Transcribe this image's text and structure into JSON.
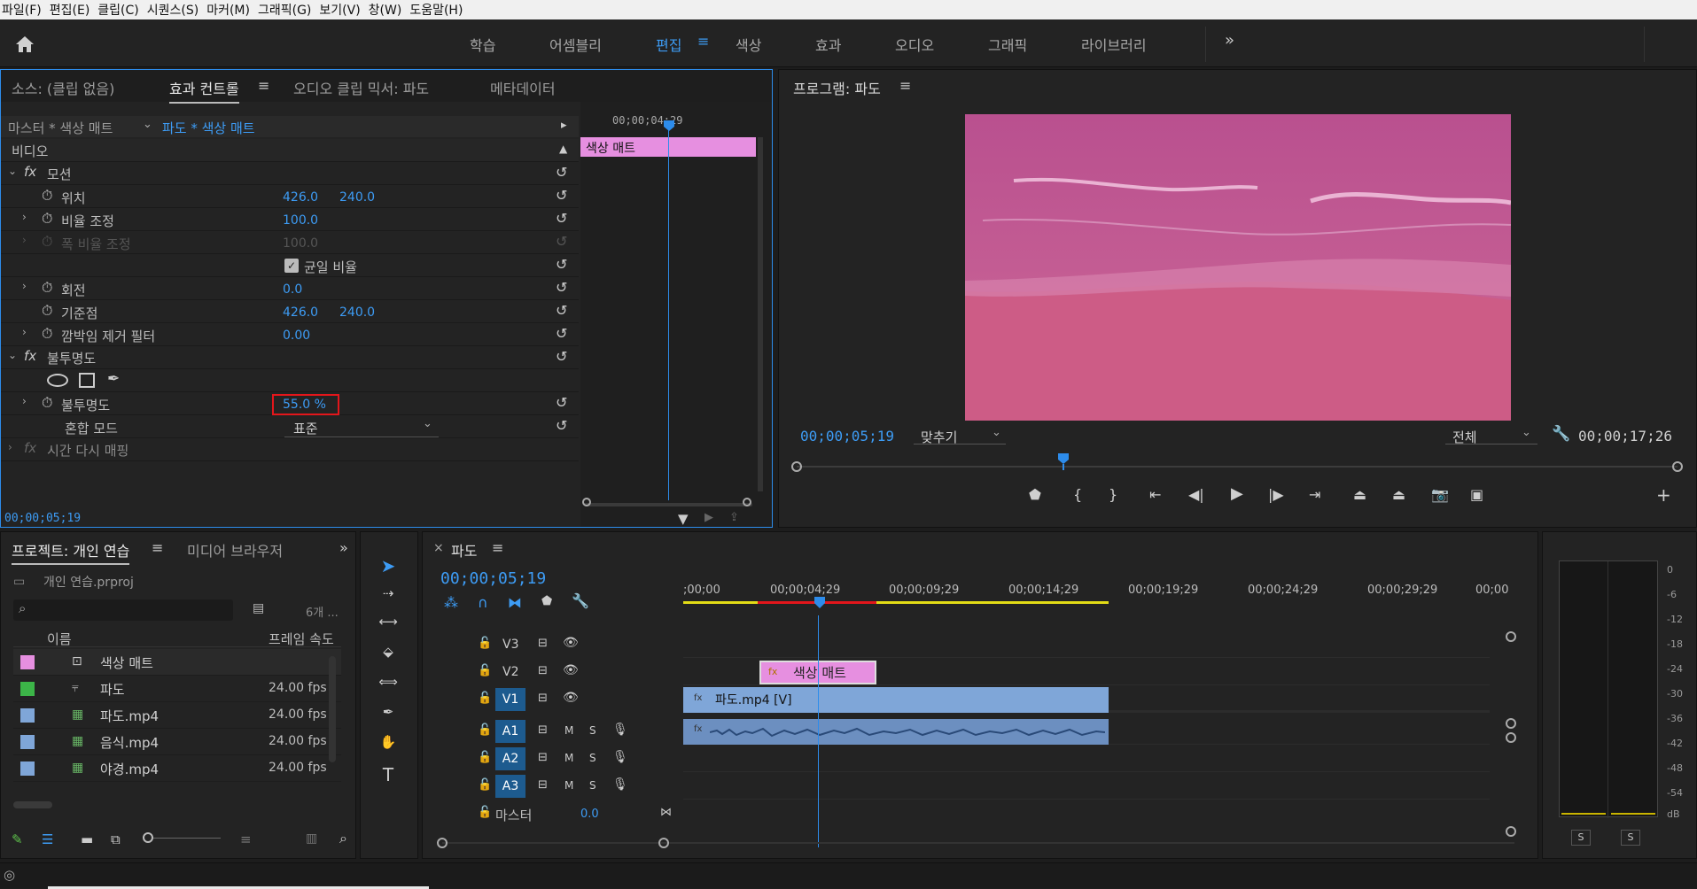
{
  "menu": [
    "파일(F)",
    "편집(E)",
    "클립(C)",
    "시퀀스(S)",
    "마커(M)",
    "그래픽(G)",
    "보기(V)",
    "창(W)",
    "도움말(H)"
  ],
  "workspaces": [
    "학습",
    "어셈블리",
    "편집",
    "색상",
    "효과",
    "오디오",
    "그래픽",
    "라이브러리"
  ],
  "workspace_active": "편집",
  "effect_panel": {
    "tabs": [
      "소스: (클립 없음)",
      "효과 컨트롤",
      "오디오 클립 믹서: 파도",
      "메타데이터"
    ],
    "master_label": "마스터 * 색상 매트",
    "clip_label": "파도 * 색상 매트",
    "mini_timecode": "00;00;04;29",
    "clip_bar": "색상 매트",
    "section_video": "비디오",
    "motion": "모션",
    "position": {
      "label": "위치",
      "x": "426.0",
      "y": "240.0"
    },
    "scale": {
      "label": "비율 조정",
      "value": "100.0"
    },
    "scale_width": {
      "label": "폭 비율 조정",
      "value": "100.0"
    },
    "uniform": "균일 비율",
    "rotation": {
      "label": "회전",
      "value": "0.0"
    },
    "anchor": {
      "label": "기준점",
      "x": "426.0",
      "y": "240.0"
    },
    "flicker": {
      "label": "깜박임 제거 필터",
      "value": "0.00"
    },
    "opacity_section": "불투명도",
    "opacity": {
      "label": "불투명도",
      "value": "55.0 %"
    },
    "blend": {
      "label": "혼합 모드",
      "value": "표준"
    },
    "time_remap": "시간 다시 매핑",
    "timecode": "00;00;05;19"
  },
  "program": {
    "title": "프로그램: 파도",
    "timecode": "00;00;05;19",
    "fit": "맞추기",
    "quality": "전체",
    "duration": "00;00;17;26"
  },
  "project": {
    "tabs": [
      "프로젝트: 개인 연습",
      "미디어 브라우저"
    ],
    "file": "개인 연습.prproj",
    "count": "6개 ...",
    "col_name": "이름",
    "col_fps": "프레임 속도",
    "items": [
      {
        "name": "색상 매트",
        "fps": "",
        "color": "#e68fe0"
      },
      {
        "name": "파도",
        "fps": "24.00 fps",
        "color": "#3cb548"
      },
      {
        "name": "파도.mp4",
        "fps": "24.00 fps",
        "color": "#7fa6d8"
      },
      {
        "name": "음식.mp4",
        "fps": "24.00 fps",
        "color": "#7fa6d8"
      },
      {
        "name": "야경.mp4",
        "fps": "24.00 fps",
        "color": "#7fa6d8"
      }
    ]
  },
  "timeline": {
    "tab": "파도",
    "timecode": "00;00;05;19",
    "ruler": [
      ";00;00",
      "00;00;04;29",
      "00;00;09;29",
      "00;00;14;29",
      "00;00;19;29",
      "00;00;24;29",
      "00;00;29;29",
      "00;00"
    ],
    "tracks_video": [
      "V3",
      "V2",
      "V1"
    ],
    "tracks_audio": [
      "A1",
      "A2",
      "A3"
    ],
    "master": "마스터",
    "master_val": "0.0",
    "clip_matte": "색상 매트",
    "clip_video": "파도.mp4 [V]"
  },
  "meter": {
    "scale": [
      "0",
      "-6",
      "-12",
      "-18",
      "-24",
      "-30",
      "-36",
      "-42",
      "-48",
      "-54",
      "dB"
    ],
    "solo": "S"
  },
  "colors": {
    "accent": "#2d8ceb",
    "matte": "#e68fe0",
    "clip": "#7fa6d8",
    "opacity_box": "#e3161b"
  }
}
